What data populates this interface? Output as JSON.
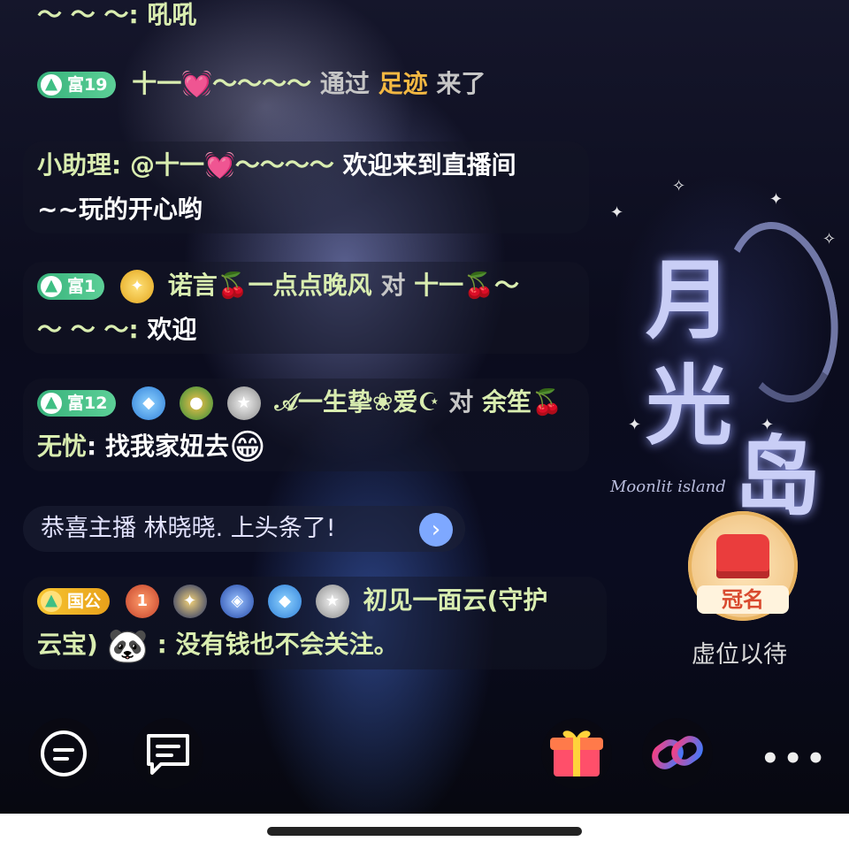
{
  "background": {
    "title": "月光岛",
    "title_chars": [
      "月",
      "光",
      "岛"
    ],
    "subtitle": "Moonlit island"
  },
  "messages": [
    {
      "id": "m0",
      "tail": "～ ～ ～: 吼吼"
    },
    {
      "id": "m1",
      "rich_level": "富19",
      "user": "十一💓～～～～",
      "action_prefix": "通过",
      "action_highlight": "足迹",
      "action_suffix": "来了"
    },
    {
      "id": "m2",
      "sender": "小助理",
      "colon": ": ",
      "mention": "@十一💓～～～～",
      "text1": "欢迎来到直播间",
      "text2": "~~玩的开心哟"
    },
    {
      "id": "m3",
      "rich_level": "富1",
      "user": "诺言🍒一点点晚风",
      "verb": "对",
      "target": "十一🍒～",
      "tail": "～ ～ ～: ",
      "content": "欢迎"
    },
    {
      "id": "m4",
      "rich_level": "富12",
      "user": "𝒜一生挚❀爱☪",
      "verb": "对",
      "target": "余笙🍒",
      "target2": "无忧",
      "colon": ": ",
      "content": "找我家妞去",
      "emoji": "😁"
    },
    {
      "id": "m5",
      "guild_label": "国公",
      "level_badge": "1",
      "user": "初见一面云(守护",
      "user2": "云宝)",
      "colon": ": ",
      "content": "没有钱也不会关注。",
      "emoji": "🐼"
    }
  ],
  "notice": {
    "text": "恭喜主播 林晓晓. 上头条了!",
    "chevron": "›"
  },
  "crown": {
    "banner": "冠名",
    "caption": "虚位以待"
  },
  "toolbar": {
    "more": "•••"
  },
  "colors": {
    "nick": "#d9edb0",
    "gold": "#f3b842",
    "rich_green": "#3fbf84",
    "notice_chevron": "#7ea8ff"
  },
  "icons": [
    "chat-bubble-icon",
    "message-square-icon",
    "gift-icon",
    "link-icon",
    "more-dots-icon"
  ]
}
